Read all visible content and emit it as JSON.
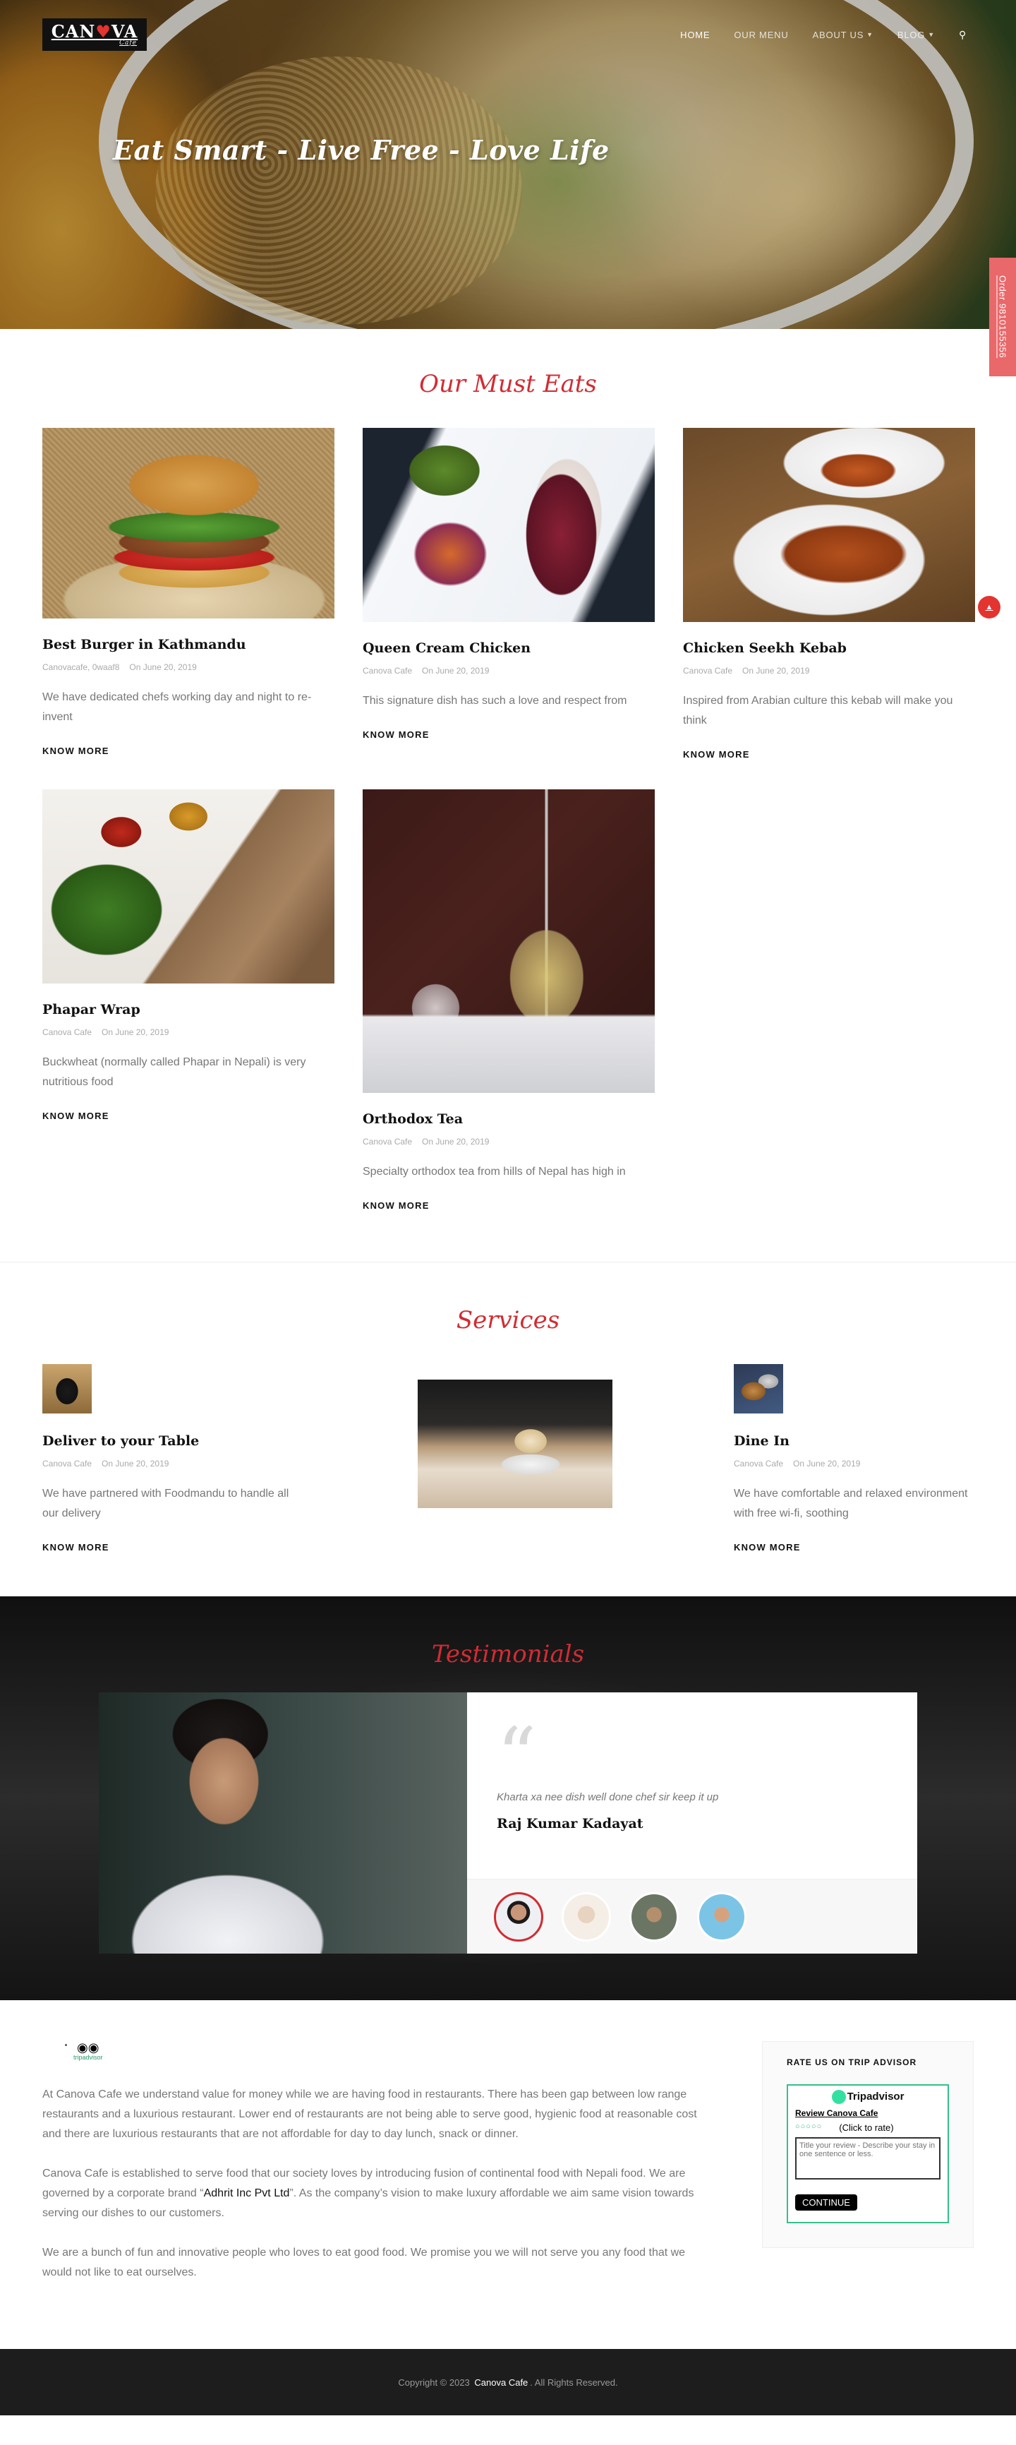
{
  "brand": {
    "logo_main_1": "CAN",
    "logo_main_dot": "♥",
    "logo_main_2": "VA",
    "logo_sub": "Cafe"
  },
  "nav": {
    "items": [
      {
        "label": "HOME",
        "active": true,
        "dropdown": false
      },
      {
        "label": "OUR MENU",
        "active": false,
        "dropdown": false
      },
      {
        "label": "ABOUT US",
        "active": false,
        "dropdown": true
      },
      {
        "label": "BLOG",
        "active": false,
        "dropdown": true
      }
    ],
    "search_icon": "search-icon"
  },
  "hero": {
    "tagline": "Eat Smart - Live Free - Love Life"
  },
  "order_tab": {
    "label": "Order 9810155356"
  },
  "must_eats": {
    "title": "Our Must Eats",
    "know_more": "KNOW MORE",
    "items": [
      {
        "title": "Best Burger in Kathmandu",
        "author": "Canovacafe, 0waaf8",
        "date": "On June 20, 2019",
        "excerpt": "We have dedicated chefs working day and night to re-invent"
      },
      {
        "title": "Queen Cream Chicken",
        "author": "Canova Cafe",
        "date": "On June 20, 2019",
        "excerpt": "This signature dish has such a love and respect from"
      },
      {
        "title": "Chicken Seekh Kebab",
        "author": "Canova Cafe",
        "date": "On June 20, 2019",
        "excerpt": "Inspired from Arabian culture this kebab will make you think"
      },
      {
        "title": "Phapar Wrap",
        "author": "Canova Cafe",
        "date": "On June 20, 2019",
        "excerpt": "Buckwheat (normally called Phapar in Nepali) is very nutritious food"
      },
      {
        "title": "Orthodox Tea",
        "author": "Canova Cafe",
        "date": "On June 20, 2019",
        "excerpt": "Specialty orthodox tea from hills of Nepal has high in"
      }
    ]
  },
  "services": {
    "title": "Services",
    "know_more": "KNOW MORE",
    "items": [
      {
        "title": "Deliver to your Table",
        "author": "Canova Cafe",
        "date": "On June 20, 2019",
        "excerpt": "We have partnered with Foodmandu to handle all our delivery"
      },
      {
        "title": "Dine In",
        "author": "Canova Cafe",
        "date": "On June 20, 2019",
        "excerpt": "We have comfortable and relaxed environment with free wi-fi, soothing"
      }
    ]
  },
  "testimonials": {
    "title": "Testimonials",
    "quote_mark": "“",
    "text": "Kharta xa nee dish well done chef sir keep it up",
    "name": "Raj Kumar Kadayat"
  },
  "about": {
    "ta_small_text": "tripadvisor",
    "paragraph1": "At Canova Cafe we understand value for money while we are having food in restaurants. There has been gap between low range restaurants and a luxurious restaurant. Lower end of restaurants are not being able to serve good, hygienic food at reasonable cost and there are luxurious restaurants that are not affordable for day to day lunch, snack or dinner.",
    "paragraph2_a": "Canova Cafe is established to serve food that our society loves by introducing fusion of continental food with Nepali food. We are governed by a corporate brand “",
    "paragraph2_brand": "Adhrit Inc Pvt Ltd",
    "paragraph2_b": "”. As the company’s vision to make luxury affordable we aim same vision towards serving our dishes to our customers.",
    "paragraph3": "We are a bunch of fun and innovative people who loves to eat good food. We promise you we will not serve you any food that we would not like to eat ourselves."
  },
  "rate_widget": {
    "title": "RATE US ON TRIP ADVISOR",
    "logo_text": "Tripadvisor",
    "review_link": "Review Canova Cafe",
    "bubbles": "○○○○○",
    "rate_hint": "(Click to rate)",
    "textarea_placeholder": "Title your review - Describe your stay in one sentence or less.",
    "continue_label": "CONTINUE"
  },
  "footer": {
    "prefix": "Copyright © 2023",
    "brand": "Canova Cafe",
    "suffix": ". All Rights Reserved."
  },
  "colors": {
    "accent": "#d12c33",
    "order_tab": "#e9686a",
    "ta_green": "#34c08a",
    "footer_bg": "#1d1d1d"
  }
}
